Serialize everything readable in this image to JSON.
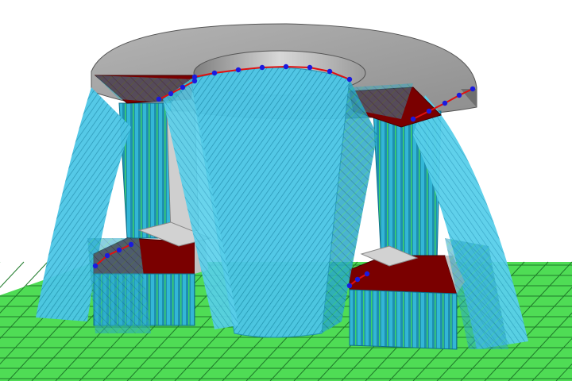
{
  "viewport": {
    "background": "#ffffff"
  },
  "colors": {
    "build_plate": "#4fdc55",
    "build_plate_grid": "#1f7a2a",
    "part_top": "#a9a9a9",
    "part_side": "#c9c9c9",
    "part_dark": "#8a8a8a",
    "overhang": "#7a0000",
    "support_fill": "#4cc6e6",
    "support_dark": "#1e8fb0",
    "support_shadow": "#0d6f8a",
    "support_green": "#3cd36a",
    "support_edge_points": "#1a1adf",
    "support_edge_line": "#e01010"
  },
  "objects": {
    "plate": "build-plate",
    "part": "ring-part",
    "supports": [
      "support-left-column",
      "support-center-cone",
      "support-right-column",
      "support-front-left-block",
      "support-front-right-block"
    ]
  }
}
